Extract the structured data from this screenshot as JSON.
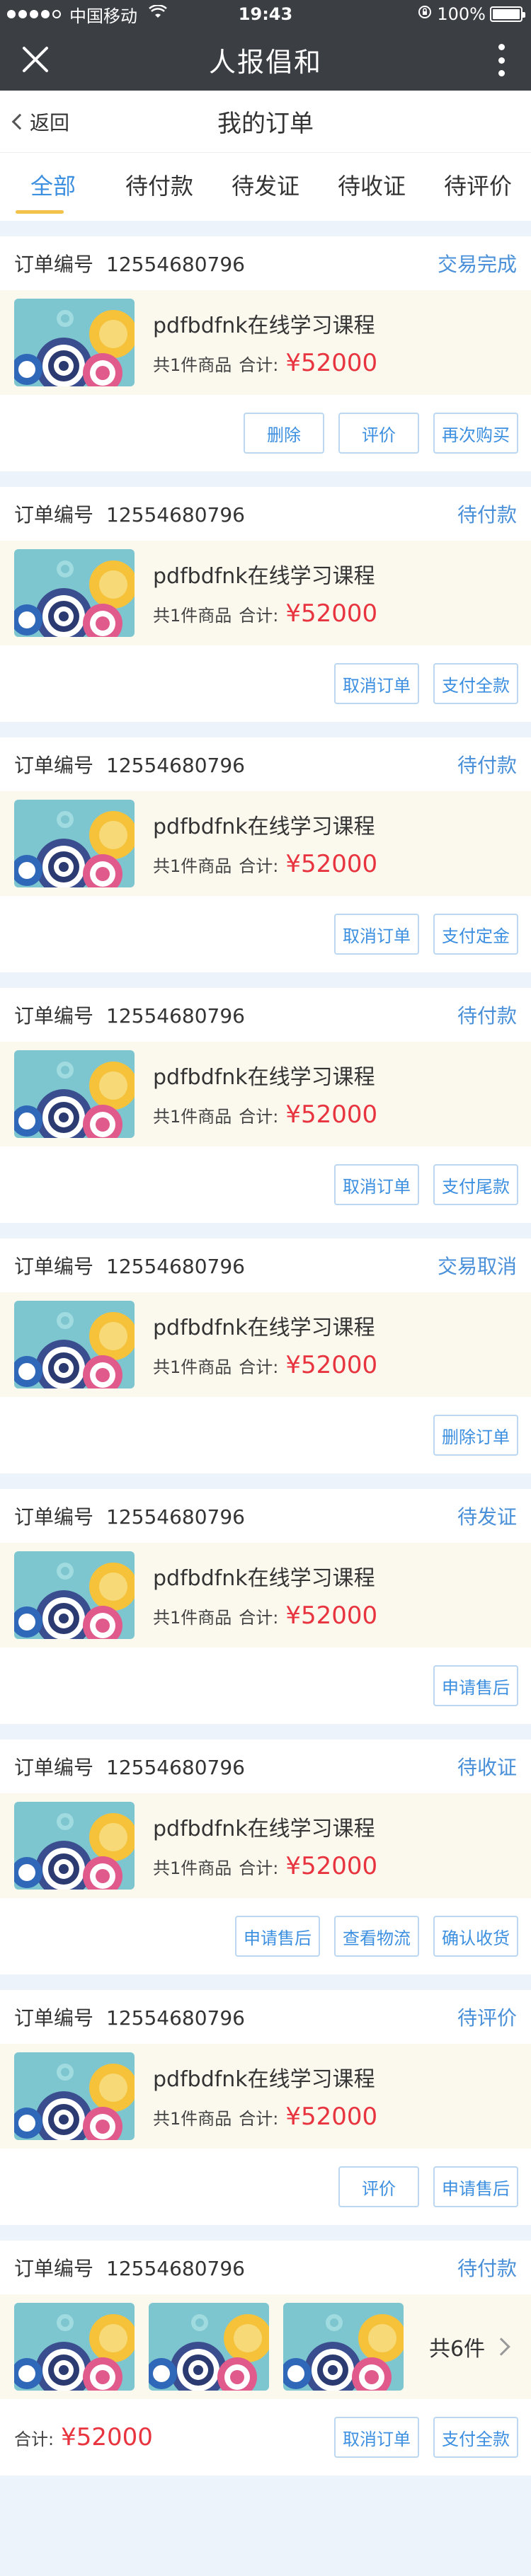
{
  "status_bar": {
    "carrier": "中国移动",
    "time": "19:43",
    "battery": "100%"
  },
  "app_title": "人报倡和",
  "nav": {
    "back_label": "返回",
    "page_title": "我的订单"
  },
  "tabs": [
    "全部",
    "待付款",
    "待发证",
    "待收证",
    "待评价"
  ],
  "labels": {
    "order_no_label": "订单编号",
    "item_count": "共1件商品",
    "total_label": "合计:"
  },
  "orders": [
    {
      "order_no": "12554680796",
      "status": "交易完成",
      "title": "pdfbdfnk在线学习课程",
      "price": "¥52000",
      "actions": [
        "删除",
        "评价",
        "再次购买"
      ]
    },
    {
      "order_no": "12554680796",
      "status": "待付款",
      "title": "pdfbdfnk在线学习课程",
      "price": "¥52000",
      "actions": [
        "取消订单",
        "支付全款"
      ]
    },
    {
      "order_no": "12554680796",
      "status": "待付款",
      "title": "pdfbdfnk在线学习课程",
      "price": "¥52000",
      "actions": [
        "取消订单",
        "支付定金"
      ]
    },
    {
      "order_no": "12554680796",
      "status": "待付款",
      "title": "pdfbdfnk在线学习课程",
      "price": "¥52000",
      "actions": [
        "取消订单",
        "支付尾款"
      ]
    },
    {
      "order_no": "12554680796",
      "status": "交易取消",
      "title": "pdfbdfnk在线学习课程",
      "price": "¥52000",
      "actions": [
        "删除订单"
      ]
    },
    {
      "order_no": "12554680796",
      "status": "待发证",
      "title": "pdfbdfnk在线学习课程",
      "price": "¥52000",
      "actions": [
        "申请售后"
      ]
    },
    {
      "order_no": "12554680796",
      "status": "待收证",
      "title": "pdfbdfnk在线学习课程",
      "price": "¥52000",
      "actions": [
        "申请售后",
        "查看物流",
        "确认收货"
      ]
    },
    {
      "order_no": "12554680796",
      "status": "待评价",
      "title": "pdfbdfnk在线学习课程",
      "price": "¥52000",
      "actions": [
        "评价",
        "申请售后"
      ]
    }
  ],
  "multi_order": {
    "order_no": "12554680796",
    "status": "待付款",
    "item_total": "共6件",
    "total_label": "合计:",
    "price": "¥52000",
    "actions": [
      "取消订单",
      "支付全款"
    ]
  },
  "colors": {
    "accent": "#3d8fe0",
    "price": "#e8343f",
    "tab_indicator": "#f3c24a",
    "header_bg": "#3b3f44"
  }
}
